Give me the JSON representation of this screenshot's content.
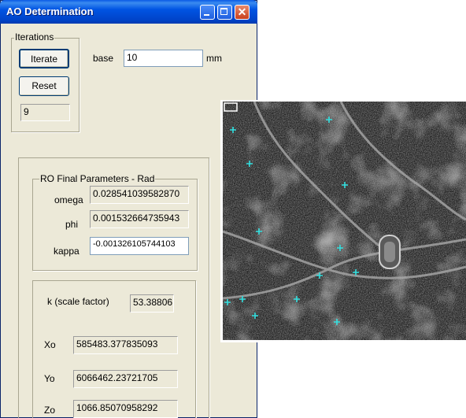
{
  "window": {
    "title": "AO Determination"
  },
  "iterations": {
    "group_label": "Iterations",
    "iterate_label": "Iterate",
    "reset_label": "Reset",
    "count": "9"
  },
  "base": {
    "label": "base",
    "value": "10",
    "unit": "mm"
  },
  "ro_params": {
    "group_label": "RO Final Parameters - Rad",
    "omega_label": "omega",
    "omega_value": "0.028541039582870",
    "phi_label": "phi",
    "phi_value": "0.001532664735943",
    "kappa_label": "kappa",
    "kappa_value": "-0.001326105744103"
  },
  "results": {
    "k_label": "k (scale factor)",
    "k_value": "53.38806",
    "xo_label": "Xo",
    "xo_value": "585483.377835093",
    "yo_label": "Yo",
    "yo_value": "6066462.23721705",
    "zo_label": "Zo",
    "zo_value": "1066.85070958292"
  },
  "image": {
    "kind": "aerial photograph with control point markers",
    "marker_color": "#33e0e0"
  }
}
